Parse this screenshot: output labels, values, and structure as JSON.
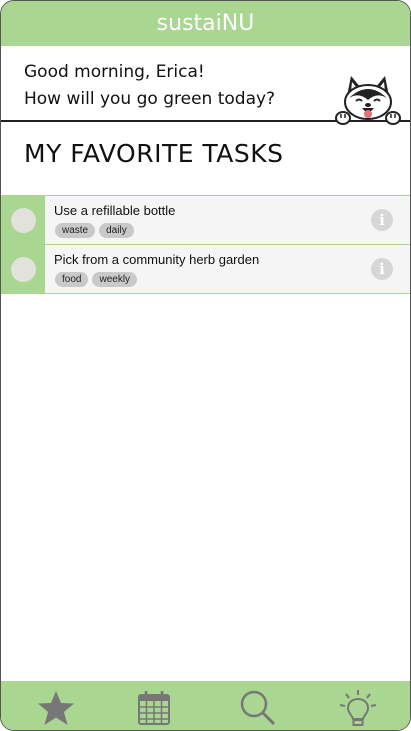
{
  "app": {
    "title": "sustaiNU"
  },
  "greeting": {
    "line1": "Good morning, Erica!",
    "line2": "How will you go green today?"
  },
  "section": {
    "title": "MY FAVORITE TASKS"
  },
  "tasks": [
    {
      "title": "Use a refillable bottle",
      "tags": [
        "waste",
        "daily"
      ]
    },
    {
      "title": "Pick from a community herb garden",
      "tags": [
        "food",
        "weekly"
      ]
    }
  ],
  "info_glyph": "i",
  "nav": [
    {
      "icon": "star-icon"
    },
    {
      "icon": "calendar-icon"
    },
    {
      "icon": "search-icon"
    },
    {
      "icon": "lightbulb-icon"
    }
  ],
  "colors": {
    "accent": "#a9d690",
    "row_bg": "#f5f5f5",
    "tag_bg": "#c9c9c9",
    "icon_gray": "#777777"
  }
}
